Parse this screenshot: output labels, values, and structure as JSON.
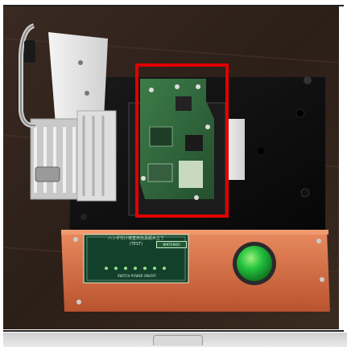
{
  "scene": {
    "description_free": true,
    "highlight_color": "#e00000",
    "button_color": "#1fb53a",
    "case_color": "#e0784e",
    "board_color": "#2f6b3c",
    "base_color": "#0d0d0d"
  },
  "panel": {
    "title_line": "ハンダ付け検査用治具組み立て",
    "subtitle": "(TEST)",
    "tag": "NINTENDO",
    "note": "SWITCH POWER ON/OFF"
  },
  "icons": [
    "handle-icon",
    "power-button-icon"
  ]
}
